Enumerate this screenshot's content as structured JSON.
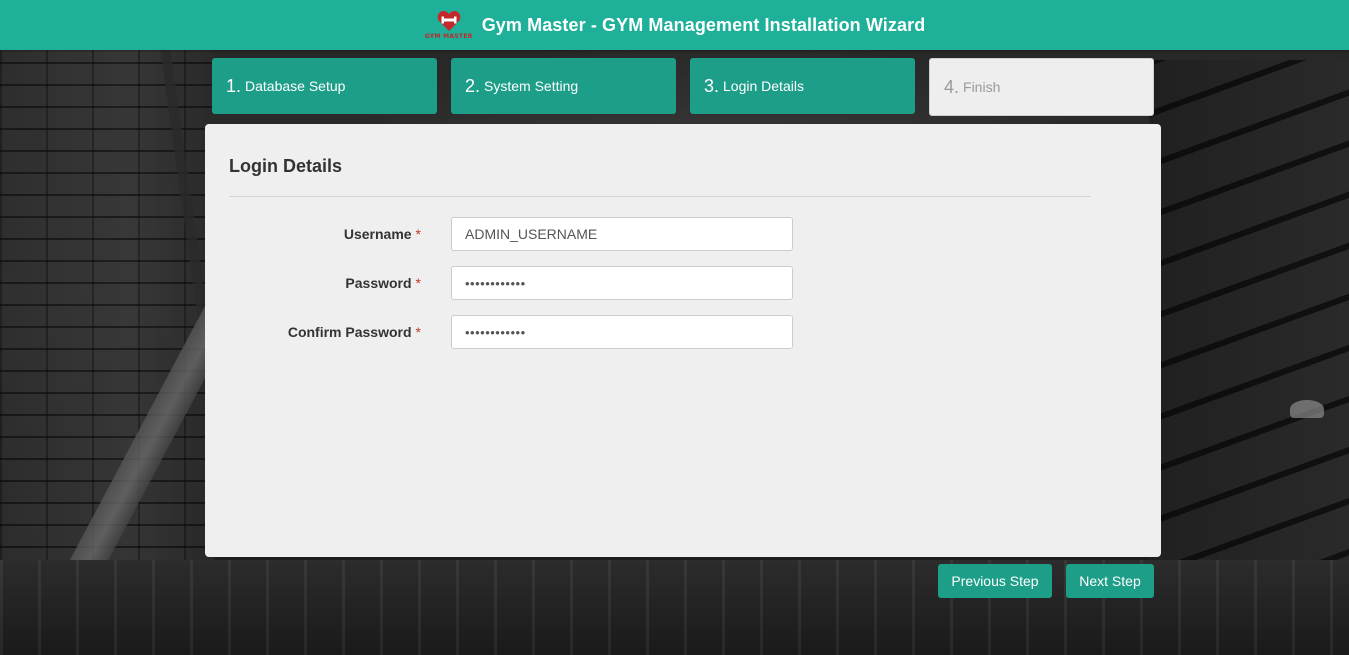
{
  "header": {
    "title": "Gym Master - GYM Management Installation Wizard",
    "logo_text": "GYM MASTER",
    "logo_icon": "heart-dumbbell-logo-icon"
  },
  "steps": [
    {
      "num": "1.",
      "label": "Database Setup",
      "state": "done"
    },
    {
      "num": "2.",
      "label": "System Setting",
      "state": "done"
    },
    {
      "num": "3.",
      "label": "Login Details",
      "state": "current"
    },
    {
      "num": "4.",
      "label": "Finish",
      "state": "disabled"
    }
  ],
  "card": {
    "title": "Login Details",
    "fields": {
      "username": {
        "label": "Username",
        "required": "*",
        "value": "ADMIN_USERNAME"
      },
      "password": {
        "label": "Password",
        "required": "*",
        "value": "••••••••••••"
      },
      "confirm": {
        "label": "Confirm Password",
        "required": "*",
        "value": "••••••••••••"
      }
    }
  },
  "buttons": {
    "previous": "Previous Step",
    "next": "Next Step"
  },
  "colors": {
    "accent": "#1eb099",
    "step_active": "#1d9e88",
    "step_disabled": "#eeeeee",
    "required": "#c0392b",
    "logo": "#c4282b"
  }
}
